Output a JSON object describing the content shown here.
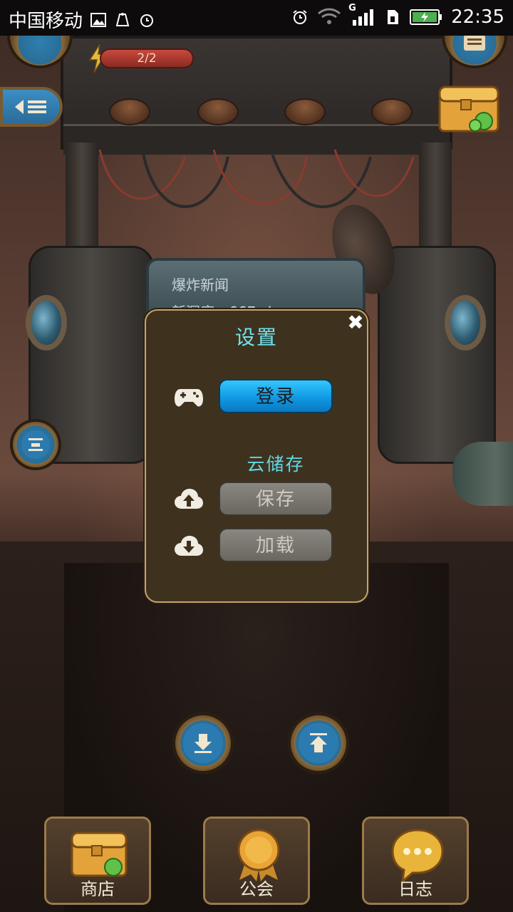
{
  "status_bar": {
    "carrier": "中国移动",
    "time": "22:35",
    "network_type": "G",
    "icons": [
      "image-icon",
      "usb-icon",
      "timer-icon",
      "alarm-icon",
      "wifi-icon",
      "signal-icon",
      "sim-icon",
      "battery-icon"
    ]
  },
  "hud": {
    "energy_text": "2/2"
  },
  "background": {
    "news_title": "爆炸新闻",
    "news_line2": "新深度：667+k"
  },
  "dialog": {
    "title": "设置",
    "close_label": "✖",
    "login_label": "登录",
    "cloud_section_label": "云储存",
    "save_label": "保存",
    "load_label": "加载"
  },
  "bottom_nav": {
    "items": [
      {
        "label": "商店",
        "icon": "chest-icon"
      },
      {
        "label": "公会",
        "icon": "medal-icon"
      },
      {
        "label": "日志",
        "icon": "chat-bubble-icon"
      }
    ]
  },
  "colors": {
    "dialog_bg": "#3e321f",
    "dialog_border": "#c9a36a",
    "accent_cyan": "#6fe3f0",
    "login_blue": "#1aa3ec",
    "disabled_gray": "#7a7770"
  }
}
